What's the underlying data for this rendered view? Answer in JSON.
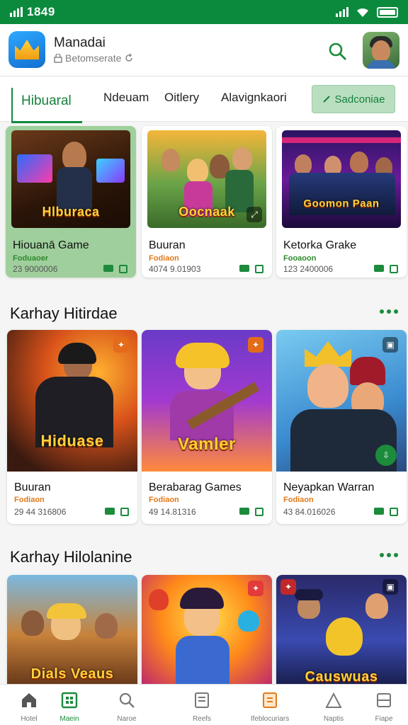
{
  "status": {
    "time": "1849"
  },
  "header": {
    "title": "Manadai",
    "subtitle": "Betomserate",
    "search_icon": "search-icon",
    "avatar": "user-avatar"
  },
  "tabs": {
    "active": "Hibuaral",
    "items": [
      "Ndeuam",
      "Oitlery",
      "Alavignkaori"
    ],
    "cta_label": "Sadconiae"
  },
  "row1": [
    {
      "thumb_title": "Hlburaca",
      "name": "Hiouanā Game",
      "meta": "Foduaoer",
      "stat": "23 9000006"
    },
    {
      "thumb_title": "Oocnaak",
      "name": "Buuran",
      "meta": "Fodiaon",
      "stat": "4074 9.01903"
    },
    {
      "thumb_title": "Goomon Paan",
      "name": "Ketorka Grake",
      "meta": "Fooaoon",
      "stat": "123 2400006"
    }
  ],
  "section2": {
    "title": "Karhay Hitirdae"
  },
  "row2": [
    {
      "thumb_title": "Hiduase",
      "name": "Buuran",
      "meta": "Fodiaon",
      "stat": "29 44 316806"
    },
    {
      "thumb_title": "Vamler",
      "name": "Berabarag Games",
      "meta": "Fodiaon",
      "stat": "49 14.81316"
    },
    {
      "thumb_title": "",
      "name": "Neyapkan Warran",
      "meta": "Fodiaon",
      "stat": "43 84.016026"
    }
  ],
  "section3": {
    "title": "Karhay Hilolanine"
  },
  "row3": [
    {
      "thumb_title": "Dials Veaus"
    },
    {
      "thumb_title": ""
    },
    {
      "thumb_title": "Causwuas"
    }
  ],
  "nav": [
    {
      "label": "Hotel",
      "icon": "home-icon"
    },
    {
      "label": "Maein",
      "icon": "grid-icon"
    },
    {
      "label": "Naroe",
      "icon": "search-icon"
    },
    {
      "label": "Reefs",
      "icon": "news-icon"
    },
    {
      "label": "Ifeblocuriars",
      "icon": "library-icon"
    },
    {
      "label": "Naptis",
      "icon": "tent-icon"
    },
    {
      "label": "Fiape",
      "icon": "folder-icon"
    }
  ],
  "colors": {
    "brand_green": "#0b8a3e",
    "accent_orange": "#e07a1c"
  }
}
